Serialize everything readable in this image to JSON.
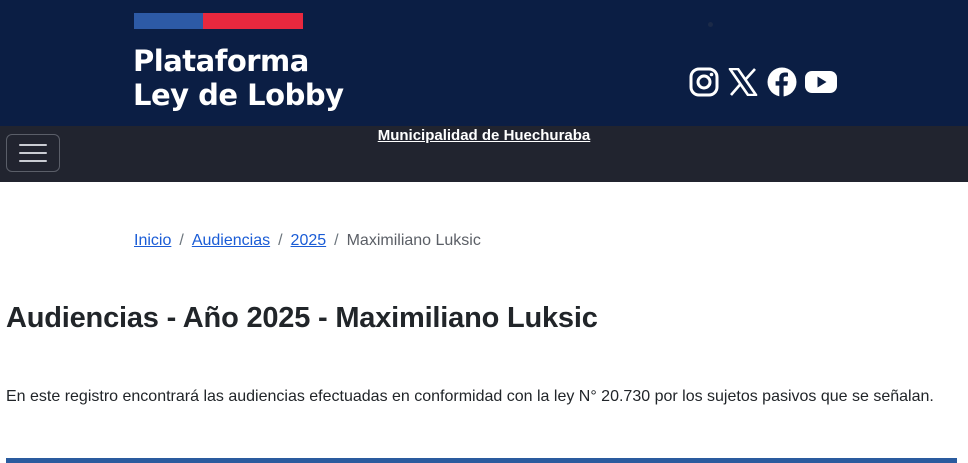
{
  "header": {
    "brand_line1": "Plataforma",
    "brand_line2": "Ley de Lobby",
    "flag_colors": {
      "blue": "#2d5aa6",
      "red": "#e8283e"
    },
    "social_icons": [
      "instagram-icon",
      "x-icon",
      "facebook-icon",
      "youtube-icon"
    ]
  },
  "navbar": {
    "municipality": "Municipalidad de Huechuraba",
    "menu_icon": "hamburger-icon"
  },
  "breadcrumb": {
    "items": [
      "Inicio",
      "Audiencias",
      "2025"
    ],
    "separator": "/",
    "current": "Maximiliano Luksic"
  },
  "main": {
    "title": "Audiencias - Año 2025 - Maximiliano Luksic",
    "description": "En este registro encontrará las audiencias efectuadas en conformidad con la ley N° 20.730 por los sujetos pasivos que se señalan."
  },
  "colors": {
    "header_bg": "#0b1e44",
    "navbar_bg": "#21242f",
    "link": "#1a5cd6",
    "accent_bar": "#2a5b9e"
  }
}
